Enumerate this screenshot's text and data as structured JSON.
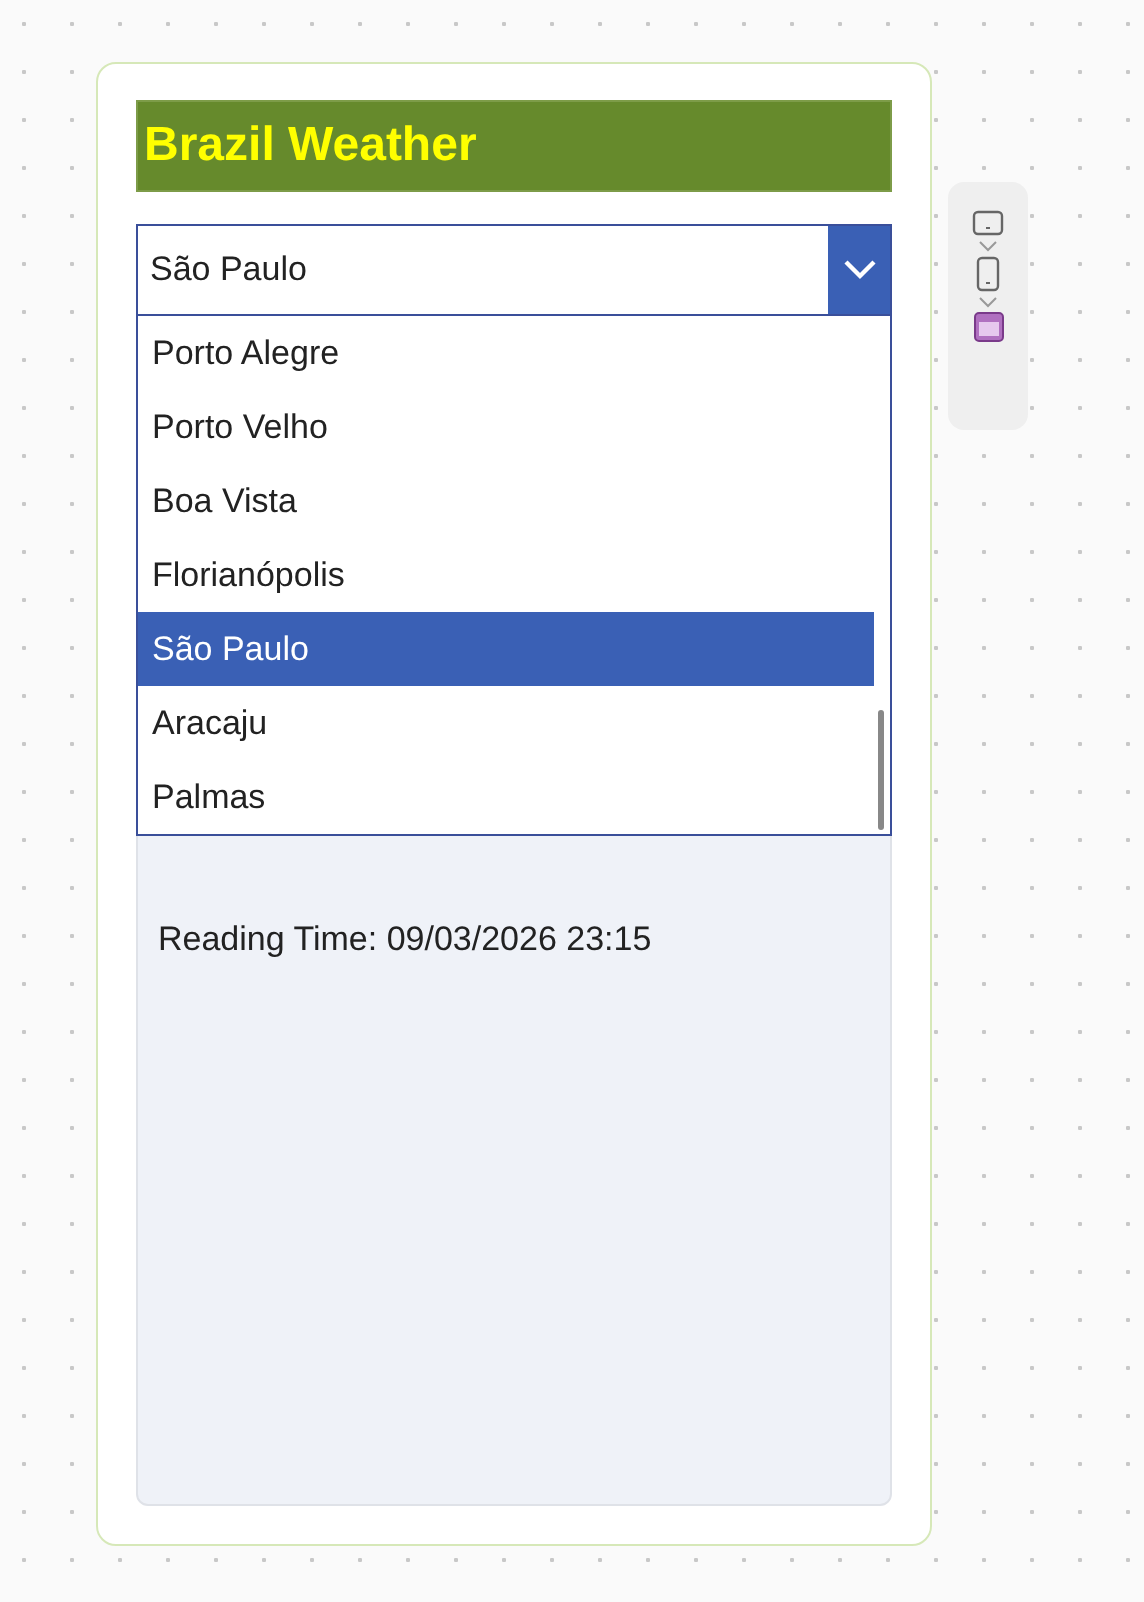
{
  "app": {
    "title": "Brazil Weather"
  },
  "dropdown": {
    "value": "São Paulo",
    "expanded": true,
    "options": [
      {
        "label": "Porto Alegre",
        "selected": false
      },
      {
        "label": "Porto Velho",
        "selected": false
      },
      {
        "label": "Boa Vista",
        "selected": false
      },
      {
        "label": "Florianópolis",
        "selected": false
      },
      {
        "label": "São Paulo",
        "selected": true
      },
      {
        "label": "Aracaju",
        "selected": false
      },
      {
        "label": "Palmas",
        "selected": false
      }
    ]
  },
  "details": [
    "Reading Time: 09/03/2026 23:15"
  ]
}
